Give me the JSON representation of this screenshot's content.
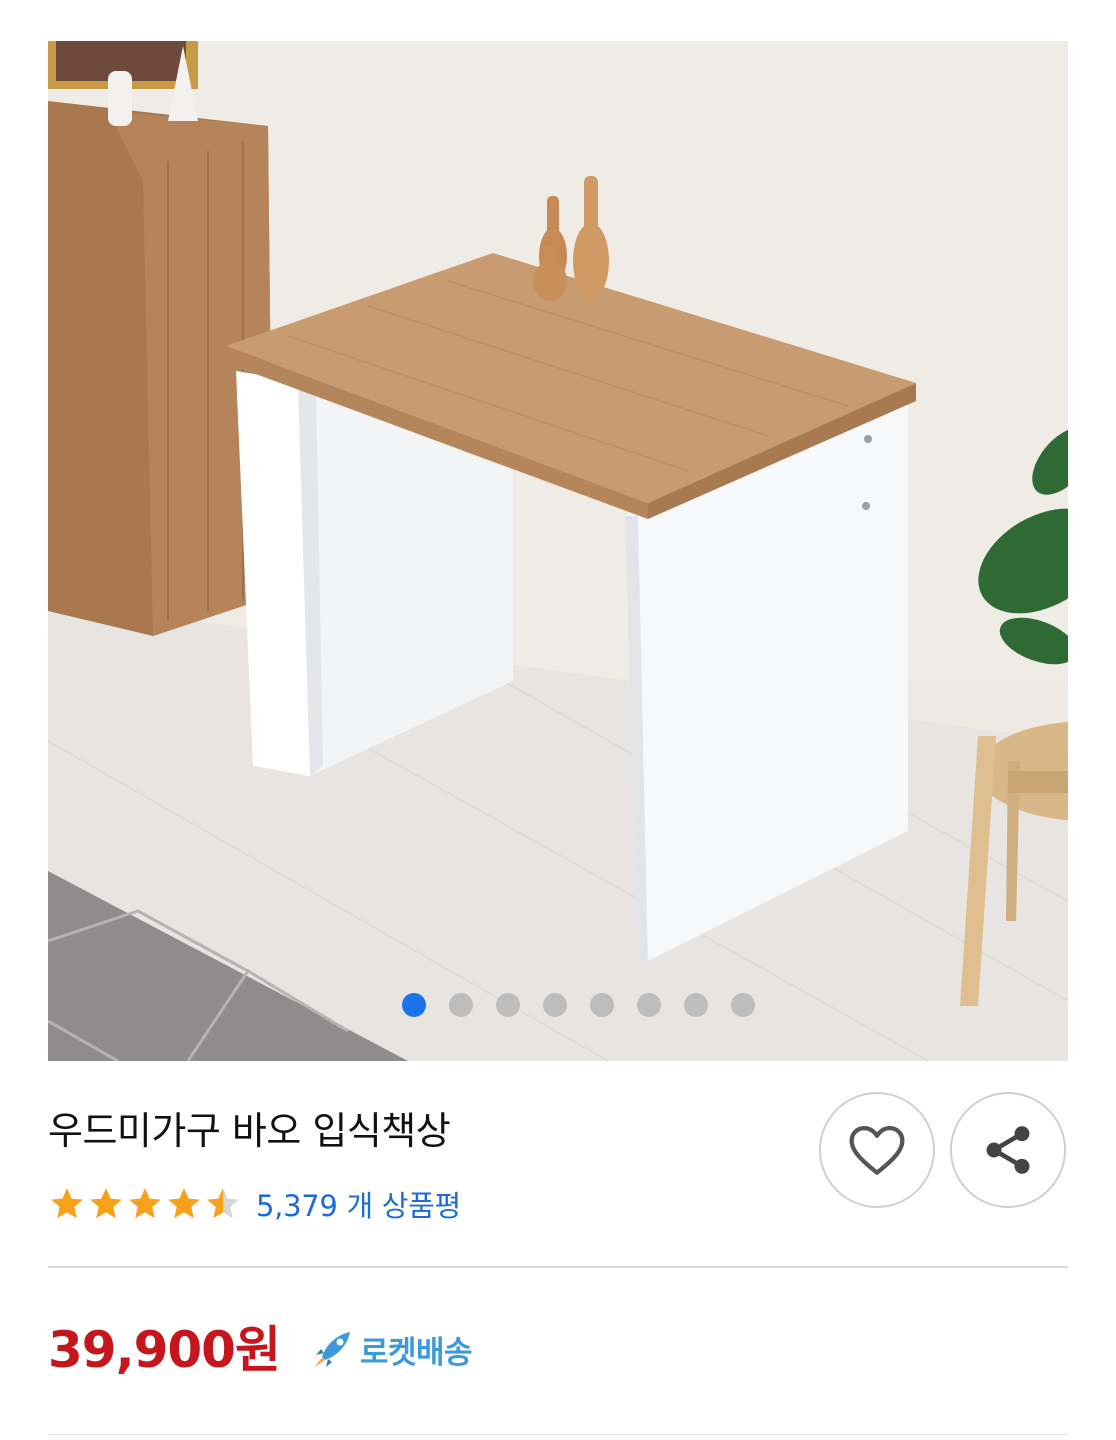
{
  "product": {
    "title": "우드미가구 바오 입식책상",
    "rating": 4.5,
    "review_count": "5,379 개 상품평",
    "price": "39,900원",
    "delivery_badge": "로켓배송"
  },
  "carousel": {
    "total": 8,
    "active_index": 0
  },
  "colors": {
    "accent": "#1a73e8",
    "price": "#c4161c",
    "review_link": "#1d6bd6",
    "star": "#f7a11a",
    "rocket": "#3b9ad9"
  },
  "icons": {
    "like": "heart-outline-icon",
    "share": "share-icon",
    "delivery": "rocket-icon",
    "rating": "star-icon"
  }
}
